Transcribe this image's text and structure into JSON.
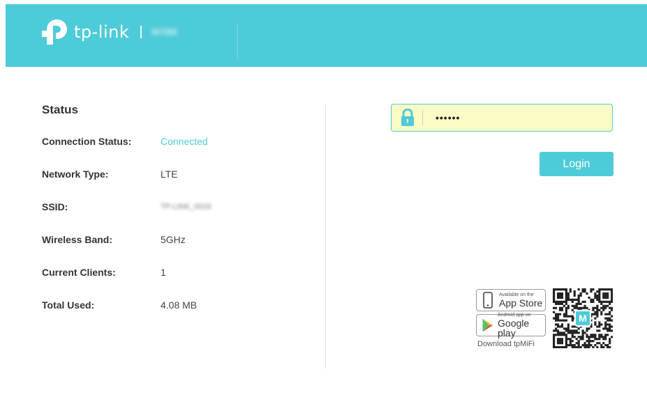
{
  "header": {
    "brand": "tp-link",
    "model": "M7350"
  },
  "status": {
    "title": "Status",
    "rows": [
      {
        "label": "Connection Status:",
        "value": "Connected"
      },
      {
        "label": "Network Type:",
        "value": "LTE"
      },
      {
        "label": "SSID:",
        "value": "TP-LINK_0016"
      },
      {
        "label": "Wireless Band:",
        "value": "5GHz"
      },
      {
        "label": "Current Clients:",
        "value": "1"
      },
      {
        "label": "Total Used:",
        "value": "4.08 MB"
      }
    ]
  },
  "login": {
    "password_value": "••••••",
    "button_label": "Login"
  },
  "app": {
    "appstore_small": "Available on the",
    "appstore_big": "App Store",
    "googleplay_small": "Android app on",
    "googleplay_big": "Google play",
    "download_text": "Download tpMiFi",
    "qr_badge": "M"
  },
  "colors": {
    "accent": "#4ecbd8",
    "password_bg": "#fafbc5"
  }
}
